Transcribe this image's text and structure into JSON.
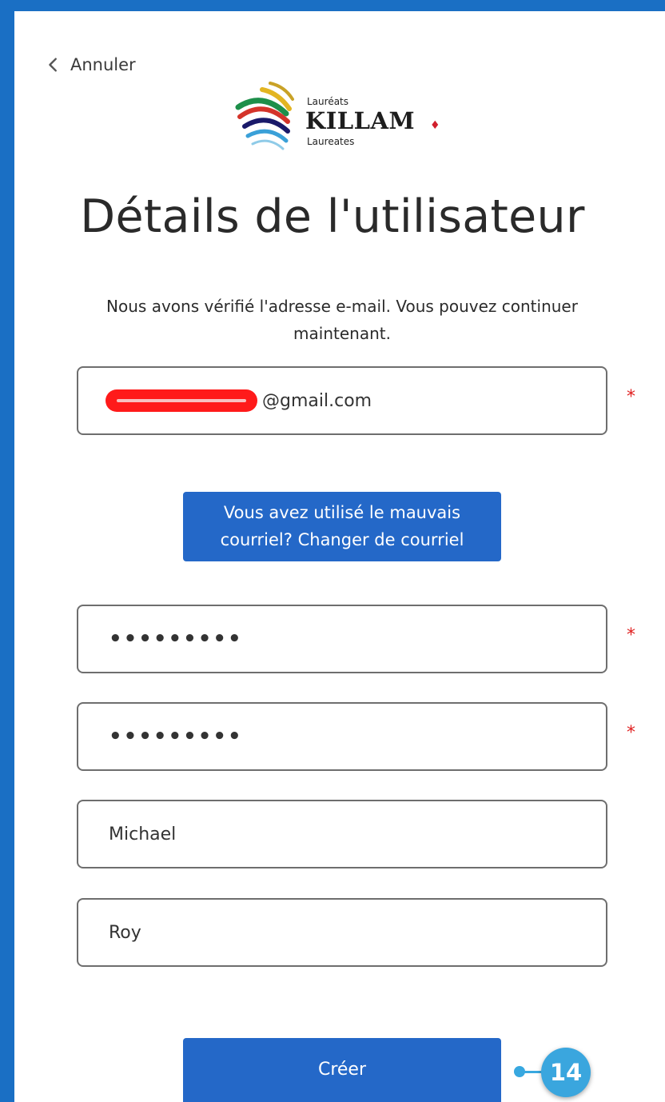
{
  "nav": {
    "back_label": "Annuler"
  },
  "logo": {
    "top_text": "Lauréats",
    "main_text": "KILLAM",
    "bottom_text": "Laureates",
    "leaf": "♦"
  },
  "page": {
    "title": "Détails de l'utilisateur",
    "intro": "Nous avons vérifié l'adresse e-mail. Vous pouvez continuer maintenant."
  },
  "form": {
    "email_domain": "@gmail.com",
    "required_marker": "*",
    "password": "•••••••••",
    "confirm_password": "•••••••••",
    "first_name": "Michael",
    "last_name": "Roy"
  },
  "buttons": {
    "change_email_line1": "Vous avez utilisé le mauvais",
    "change_email_line2": "courriel? Changer de courriel",
    "create": "Créer"
  },
  "annotation": {
    "step_number": "14"
  },
  "colors": {
    "accent": "#2468c8",
    "frame": "#1a6fc4",
    "required": "#e02020",
    "badge": "#3aa6de"
  }
}
